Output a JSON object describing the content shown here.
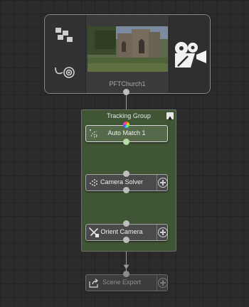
{
  "clip": {
    "name": "PFTChurch1",
    "icons": {
      "tracker": "tracker-grid-icon",
      "view": "eye-target-icon",
      "camera": "movie-camera-icon"
    }
  },
  "group": {
    "title": "Tracking Group",
    "collapse_icon": "triangle-up-icon",
    "color": "#3f5533"
  },
  "nodes": [
    {
      "label": "Auto Match 1",
      "icon": "auto-match-icon",
      "active": true
    },
    {
      "label": "Camera Solver",
      "icon": "camera-solver-icon"
    },
    {
      "label": "Orient Camera",
      "icon": "orient-camera-icon"
    },
    {
      "label": "Scene Export",
      "icon": "scene-export-icon",
      "disabled": true
    }
  ],
  "add_icon": "plus-circle-icon",
  "colors": {
    "canvas": "#2b2b2b",
    "group": "#3f5533",
    "active_node": "#56694b"
  }
}
